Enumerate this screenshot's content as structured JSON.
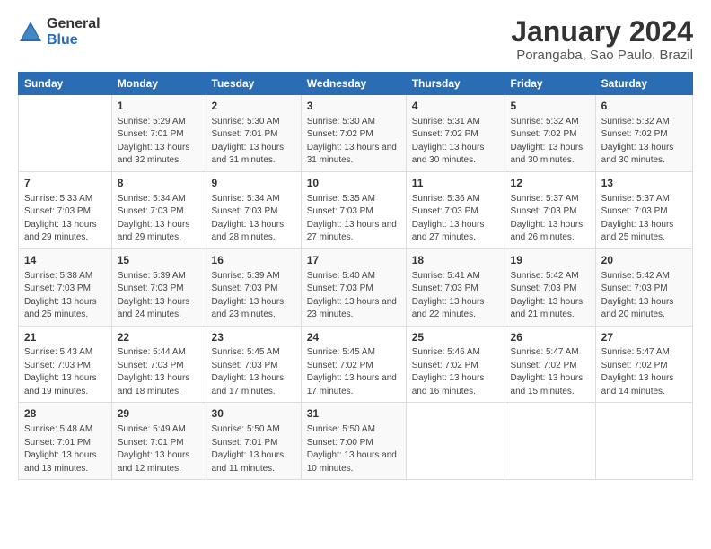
{
  "logo": {
    "general": "General",
    "blue": "Blue"
  },
  "title": "January 2024",
  "subtitle": "Porangaba, Sao Paulo, Brazil",
  "headers": [
    "Sunday",
    "Monday",
    "Tuesday",
    "Wednesday",
    "Thursday",
    "Friday",
    "Saturday"
  ],
  "weeks": [
    [
      {
        "day": "",
        "sunrise": "",
        "sunset": "",
        "daylight": ""
      },
      {
        "day": "1",
        "sunrise": "Sunrise: 5:29 AM",
        "sunset": "Sunset: 7:01 PM",
        "daylight": "Daylight: 13 hours and 32 minutes."
      },
      {
        "day": "2",
        "sunrise": "Sunrise: 5:30 AM",
        "sunset": "Sunset: 7:01 PM",
        "daylight": "Daylight: 13 hours and 31 minutes."
      },
      {
        "day": "3",
        "sunrise": "Sunrise: 5:30 AM",
        "sunset": "Sunset: 7:02 PM",
        "daylight": "Daylight: 13 hours and 31 minutes."
      },
      {
        "day": "4",
        "sunrise": "Sunrise: 5:31 AM",
        "sunset": "Sunset: 7:02 PM",
        "daylight": "Daylight: 13 hours and 30 minutes."
      },
      {
        "day": "5",
        "sunrise": "Sunrise: 5:32 AM",
        "sunset": "Sunset: 7:02 PM",
        "daylight": "Daylight: 13 hours and 30 minutes."
      },
      {
        "day": "6",
        "sunrise": "Sunrise: 5:32 AM",
        "sunset": "Sunset: 7:02 PM",
        "daylight": "Daylight: 13 hours and 30 minutes."
      }
    ],
    [
      {
        "day": "7",
        "sunrise": "Sunrise: 5:33 AM",
        "sunset": "Sunset: 7:03 PM",
        "daylight": "Daylight: 13 hours and 29 minutes."
      },
      {
        "day": "8",
        "sunrise": "Sunrise: 5:34 AM",
        "sunset": "Sunset: 7:03 PM",
        "daylight": "Daylight: 13 hours and 29 minutes."
      },
      {
        "day": "9",
        "sunrise": "Sunrise: 5:34 AM",
        "sunset": "Sunset: 7:03 PM",
        "daylight": "Daylight: 13 hours and 28 minutes."
      },
      {
        "day": "10",
        "sunrise": "Sunrise: 5:35 AM",
        "sunset": "Sunset: 7:03 PM",
        "daylight": "Daylight: 13 hours and 27 minutes."
      },
      {
        "day": "11",
        "sunrise": "Sunrise: 5:36 AM",
        "sunset": "Sunset: 7:03 PM",
        "daylight": "Daylight: 13 hours and 27 minutes."
      },
      {
        "day": "12",
        "sunrise": "Sunrise: 5:37 AM",
        "sunset": "Sunset: 7:03 PM",
        "daylight": "Daylight: 13 hours and 26 minutes."
      },
      {
        "day": "13",
        "sunrise": "Sunrise: 5:37 AM",
        "sunset": "Sunset: 7:03 PM",
        "daylight": "Daylight: 13 hours and 25 minutes."
      }
    ],
    [
      {
        "day": "14",
        "sunrise": "Sunrise: 5:38 AM",
        "sunset": "Sunset: 7:03 PM",
        "daylight": "Daylight: 13 hours and 25 minutes."
      },
      {
        "day": "15",
        "sunrise": "Sunrise: 5:39 AM",
        "sunset": "Sunset: 7:03 PM",
        "daylight": "Daylight: 13 hours and 24 minutes."
      },
      {
        "day": "16",
        "sunrise": "Sunrise: 5:39 AM",
        "sunset": "Sunset: 7:03 PM",
        "daylight": "Daylight: 13 hours and 23 minutes."
      },
      {
        "day": "17",
        "sunrise": "Sunrise: 5:40 AM",
        "sunset": "Sunset: 7:03 PM",
        "daylight": "Daylight: 13 hours and 23 minutes."
      },
      {
        "day": "18",
        "sunrise": "Sunrise: 5:41 AM",
        "sunset": "Sunset: 7:03 PM",
        "daylight": "Daylight: 13 hours and 22 minutes."
      },
      {
        "day": "19",
        "sunrise": "Sunrise: 5:42 AM",
        "sunset": "Sunset: 7:03 PM",
        "daylight": "Daylight: 13 hours and 21 minutes."
      },
      {
        "day": "20",
        "sunrise": "Sunrise: 5:42 AM",
        "sunset": "Sunset: 7:03 PM",
        "daylight": "Daylight: 13 hours and 20 minutes."
      }
    ],
    [
      {
        "day": "21",
        "sunrise": "Sunrise: 5:43 AM",
        "sunset": "Sunset: 7:03 PM",
        "daylight": "Daylight: 13 hours and 19 minutes."
      },
      {
        "day": "22",
        "sunrise": "Sunrise: 5:44 AM",
        "sunset": "Sunset: 7:03 PM",
        "daylight": "Daylight: 13 hours and 18 minutes."
      },
      {
        "day": "23",
        "sunrise": "Sunrise: 5:45 AM",
        "sunset": "Sunset: 7:03 PM",
        "daylight": "Daylight: 13 hours and 17 minutes."
      },
      {
        "day": "24",
        "sunrise": "Sunrise: 5:45 AM",
        "sunset": "Sunset: 7:02 PM",
        "daylight": "Daylight: 13 hours and 17 minutes."
      },
      {
        "day": "25",
        "sunrise": "Sunrise: 5:46 AM",
        "sunset": "Sunset: 7:02 PM",
        "daylight": "Daylight: 13 hours and 16 minutes."
      },
      {
        "day": "26",
        "sunrise": "Sunrise: 5:47 AM",
        "sunset": "Sunset: 7:02 PM",
        "daylight": "Daylight: 13 hours and 15 minutes."
      },
      {
        "day": "27",
        "sunrise": "Sunrise: 5:47 AM",
        "sunset": "Sunset: 7:02 PM",
        "daylight": "Daylight: 13 hours and 14 minutes."
      }
    ],
    [
      {
        "day": "28",
        "sunrise": "Sunrise: 5:48 AM",
        "sunset": "Sunset: 7:01 PM",
        "daylight": "Daylight: 13 hours and 13 minutes."
      },
      {
        "day": "29",
        "sunrise": "Sunrise: 5:49 AM",
        "sunset": "Sunset: 7:01 PM",
        "daylight": "Daylight: 13 hours and 12 minutes."
      },
      {
        "day": "30",
        "sunrise": "Sunrise: 5:50 AM",
        "sunset": "Sunset: 7:01 PM",
        "daylight": "Daylight: 13 hours and 11 minutes."
      },
      {
        "day": "31",
        "sunrise": "Sunrise: 5:50 AM",
        "sunset": "Sunset: 7:00 PM",
        "daylight": "Daylight: 13 hours and 10 minutes."
      },
      {
        "day": "",
        "sunrise": "",
        "sunset": "",
        "daylight": ""
      },
      {
        "day": "",
        "sunrise": "",
        "sunset": "",
        "daylight": ""
      },
      {
        "day": "",
        "sunrise": "",
        "sunset": "",
        "daylight": ""
      }
    ]
  ]
}
